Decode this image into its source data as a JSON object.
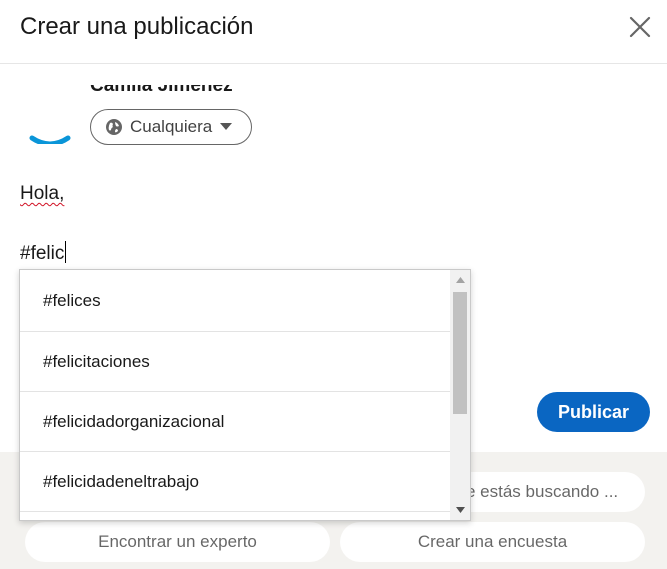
{
  "header": {
    "title": "Crear una publicación",
    "close_icon": "close-icon"
  },
  "author": {
    "name": "Camila Jiménez",
    "avatar_color": "#0a95d8"
  },
  "audience": {
    "label": "Cualquiera",
    "icon": "globe-icon"
  },
  "editor": {
    "line1": "Hola,",
    "line2": "#felic"
  },
  "hashtag_suggestions": {
    "items": [
      "#felices",
      "#felicitaciones",
      "#felicidadorganizacional",
      "#felicidadeneltrabajo"
    ]
  },
  "actions": {
    "publish_label": "Publicar",
    "publish_color": "#0a66c2"
  },
  "suggestion_pills": {
    "search_partial": "e estás buscando ...",
    "expert": "Encontrar un experto",
    "poll": "Crear una encuesta"
  }
}
